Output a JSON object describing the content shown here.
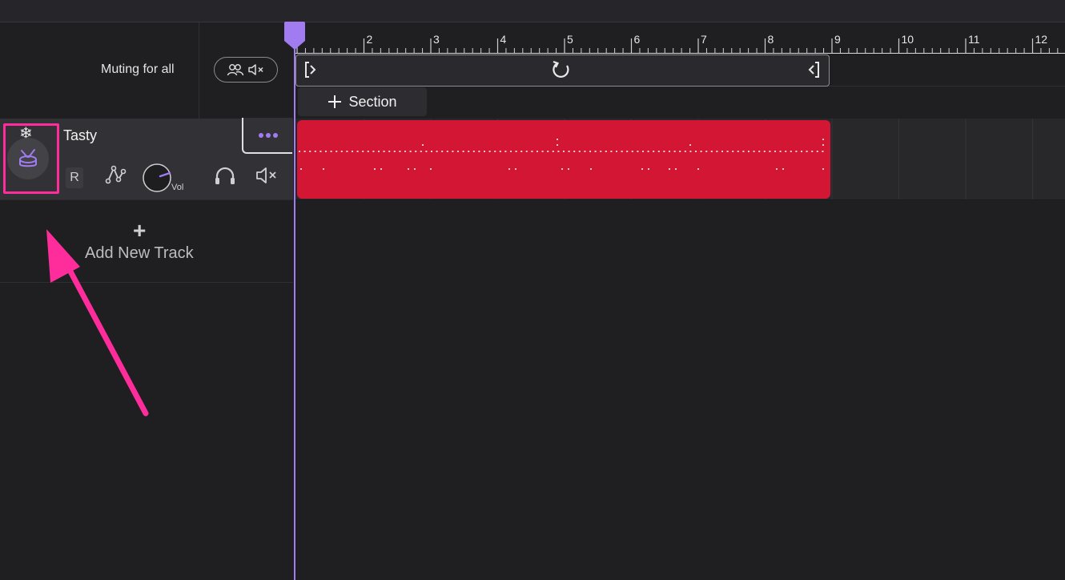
{
  "header": {
    "muting_label": "Muting for all"
  },
  "ruler": {
    "bars": [
      "2",
      "3",
      "4",
      "5",
      "6",
      "7",
      "8",
      "9",
      "10",
      "11",
      "12"
    ]
  },
  "loop": {
    "start_icon": "loop-start-bracket-icon",
    "cycle_icon": "loop-cycle-icon",
    "end_icon": "loop-end-bracket-icon"
  },
  "section_button": {
    "label": "Section"
  },
  "track": {
    "name": "Tasty",
    "record_label": "R",
    "volume_label": "Vol",
    "instrument_icon": "drum-icon",
    "freeze_icon": "snowflake-icon"
  },
  "add_track": {
    "label": "Add New Track"
  },
  "colors": {
    "accent": "#a07cf0",
    "clip": "#d31633",
    "highlight": "#ff2d9b",
    "background": "#1f1f22"
  }
}
